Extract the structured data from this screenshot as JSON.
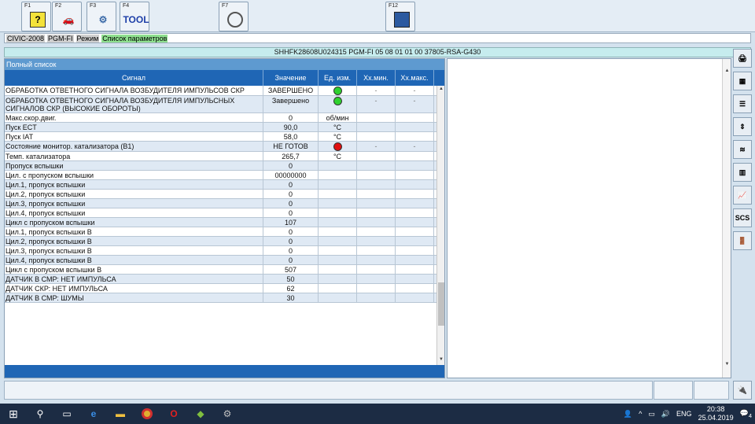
{
  "toolbar": {
    "keys": [
      {
        "label": "F1",
        "icon": "help-icon",
        "glyph": "?"
      },
      {
        "label": "F2",
        "icon": "car-icon",
        "glyph": "🚗"
      },
      {
        "label": "F3",
        "icon": "car-tools-icon",
        "glyph": "⚙"
      },
      {
        "label": "F4",
        "icon": "tool-icon",
        "glyph": "TOOL"
      },
      {
        "label": "F7",
        "icon": "magnifier-icon",
        "glyph": ""
      },
      {
        "label": "F12",
        "icon": "monitor-icon",
        "glyph": ""
      }
    ]
  },
  "infobar": {
    "model": "CIVIC-2008",
    "system": "PGM-FI",
    "mode_label": "Режим",
    "mode_value": "Список параметров"
  },
  "vinbar": {
    "text": "SHHFK28608U024315  PGM-FI  05 08 01 01 00  37805-RSA-G430"
  },
  "list": {
    "title": "Полный список",
    "columns": [
      "Сигнал",
      "Значение",
      "Ед. изм.",
      "Хх.мин.",
      "Хх.макс."
    ],
    "rows": [
      {
        "signal": "ОБРАБОТКА ОТВЕТНОГО СИГНАЛА ВОЗБУДИТЕЛЯ ИМПУЛЬСОВ СКР",
        "value": "ЗАВЕРШЕНО",
        "unit": "",
        "indicator": "green",
        "min": "-",
        "max": "-"
      },
      {
        "signal": "ОБРАБОТКА ОТВЕТНОГО СИГНАЛА ВОЗБУДИТЕЛЯ ИМПУЛЬСНЫХ СИГНАЛОВ СКР (ВЫСОКИЕ ОБОРОТЫ)",
        "value": "Завершено",
        "unit": "",
        "indicator": "green",
        "min": "-",
        "max": "-"
      },
      {
        "signal": "Макс.скор.двиг.",
        "value": "0",
        "unit": "об/мин",
        "indicator": "",
        "min": "",
        "max": ""
      },
      {
        "signal": "Пуск ECT",
        "value": "90,0",
        "unit": "°C",
        "indicator": "",
        "min": "",
        "max": ""
      },
      {
        "signal": "Пуск IAT",
        "value": "58,0",
        "unit": "°C",
        "indicator": "",
        "min": "",
        "max": ""
      },
      {
        "signal": "Состояние монитор. катализатора (B1)",
        "value": "НЕ ГОТОВ",
        "unit": "",
        "indicator": "red",
        "min": "-",
        "max": "-"
      },
      {
        "signal": "Темп. катализатора",
        "value": "265,7",
        "unit": "°C",
        "indicator": "",
        "min": "",
        "max": ""
      },
      {
        "signal": "Пропуск вспышки",
        "value": "0",
        "unit": "",
        "indicator": "",
        "min": "",
        "max": ""
      },
      {
        "signal": "Цил. с пропуском вспышки",
        "value": "00000000",
        "unit": "",
        "indicator": "",
        "min": "",
        "max": ""
      },
      {
        "signal": "Цил.1, пропуск вспышки",
        "value": "0",
        "unit": "",
        "indicator": "",
        "min": "",
        "max": ""
      },
      {
        "signal": "Цил.2, пропуск вспышки",
        "value": "0",
        "unit": "",
        "indicator": "",
        "min": "",
        "max": ""
      },
      {
        "signal": "Цил.3, пропуск вспышки",
        "value": "0",
        "unit": "",
        "indicator": "",
        "min": "",
        "max": ""
      },
      {
        "signal": "Цил.4, пропуск вспышки",
        "value": "0",
        "unit": "",
        "indicator": "",
        "min": "",
        "max": ""
      },
      {
        "signal": "Цикл с пропуском вспышки",
        "value": "107",
        "unit": "",
        "indicator": "",
        "min": "",
        "max": ""
      },
      {
        "signal": "Цил.1, пропуск вспышки B",
        "value": "0",
        "unit": "",
        "indicator": "",
        "min": "",
        "max": ""
      },
      {
        "signal": "Цил.2, пропуск вспышки B",
        "value": "0",
        "unit": "",
        "indicator": "",
        "min": "",
        "max": ""
      },
      {
        "signal": "Цил.3, пропуск вспышки B",
        "value": "0",
        "unit": "",
        "indicator": "",
        "min": "",
        "max": ""
      },
      {
        "signal": "Цил.4, пропуск вспышки B",
        "value": "0",
        "unit": "",
        "indicator": "",
        "min": "",
        "max": ""
      },
      {
        "signal": "Цикл с пропуском вспышки B",
        "value": "507",
        "unit": "",
        "indicator": "",
        "min": "",
        "max": ""
      },
      {
        "signal": "ДАТЧИК В СМР: НЕТ ИМПУЛЬСА",
        "value": "50",
        "unit": "",
        "indicator": "",
        "min": "",
        "max": ""
      },
      {
        "signal": "ДАТЧИК СКР: НЕТ ИМПУЛЬСА",
        "value": "62",
        "unit": "",
        "indicator": "",
        "min": "",
        "max": ""
      },
      {
        "signal": "ДАТЧИК В СМР: ШУМЫ",
        "value": "30",
        "unit": "",
        "indicator": "",
        "min": "",
        "max": ""
      }
    ]
  },
  "side_buttons": [
    {
      "name": "print-button",
      "glyph": "🖨"
    },
    {
      "name": "data-select-button",
      "glyph": "▦"
    },
    {
      "name": "list-button",
      "glyph": "☰"
    },
    {
      "name": "sort-button",
      "glyph": "⇕"
    },
    {
      "name": "graph-button",
      "glyph": "≋"
    },
    {
      "name": "settings-button",
      "glyph": "▥"
    },
    {
      "name": "chart-button",
      "glyph": "📈"
    },
    {
      "name": "scs-button",
      "glyph": "SCS"
    },
    {
      "name": "exit-button",
      "glyph": "🚪"
    }
  ],
  "taskbar": {
    "language": "ENG",
    "time": "20:38",
    "date": "25.04.2019",
    "notifications": "4"
  },
  "colors": {
    "header_blue": "#1f66b5",
    "title_blue": "#5e9ad0",
    "green_indicator": "#2fd12f",
    "red_indicator": "#e01010"
  }
}
